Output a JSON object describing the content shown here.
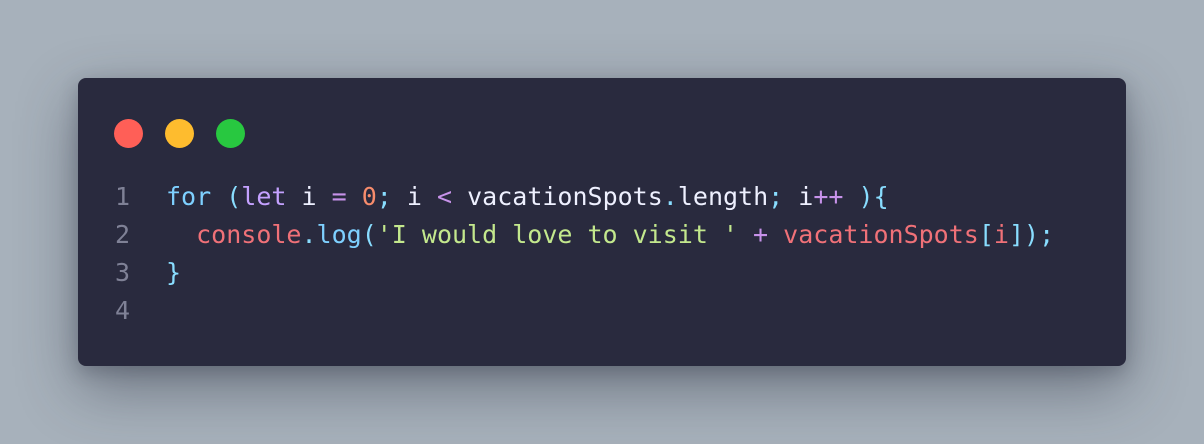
{
  "window_controls": {
    "close_color": "#ff5f57",
    "minimize_color": "#febc2e",
    "maximize_color": "#28c840"
  },
  "colors": {
    "keyword": "#7ed0ff",
    "storage": "#c4a1ff",
    "operator": "#c792ea",
    "number": "#f78c6c",
    "plain": "#eef0ff",
    "property": "#eef0ff",
    "variable_red": "#f07178",
    "string": "#c3e88d",
    "punctuation": "#89ddff",
    "line_number": "#7f8196"
  },
  "code": {
    "lines": [
      {
        "number": "1",
        "tokens": [
          {
            "text": "for",
            "type": "keyword"
          },
          {
            "text": " ",
            "type": "plain"
          },
          {
            "text": "(",
            "type": "punctuation"
          },
          {
            "text": "let",
            "type": "storage"
          },
          {
            "text": " i ",
            "type": "plain"
          },
          {
            "text": "=",
            "type": "operator"
          },
          {
            "text": " ",
            "type": "plain"
          },
          {
            "text": "0",
            "type": "number"
          },
          {
            "text": ";",
            "type": "punctuation"
          },
          {
            "text": " i ",
            "type": "plain"
          },
          {
            "text": "<",
            "type": "operator"
          },
          {
            "text": " vacationSpots",
            "type": "plain"
          },
          {
            "text": ".",
            "type": "punctuation"
          },
          {
            "text": "length",
            "type": "property"
          },
          {
            "text": ";",
            "type": "punctuation"
          },
          {
            "text": " i",
            "type": "plain"
          },
          {
            "text": "++",
            "type": "operator"
          },
          {
            "text": " ",
            "type": "plain"
          },
          {
            "text": ")",
            "type": "punctuation"
          },
          {
            "text": "{",
            "type": "punctuation"
          }
        ]
      },
      {
        "number": "2",
        "tokens": [
          {
            "text": "  ",
            "type": "plain"
          },
          {
            "text": "console",
            "type": "variable_red"
          },
          {
            "text": ".",
            "type": "punctuation"
          },
          {
            "text": "log",
            "type": "keyword"
          },
          {
            "text": "(",
            "type": "punctuation"
          },
          {
            "text": "'I would love to visit '",
            "type": "string"
          },
          {
            "text": " ",
            "type": "plain"
          },
          {
            "text": "+",
            "type": "operator"
          },
          {
            "text": " ",
            "type": "plain"
          },
          {
            "text": "vacationSpots",
            "type": "variable_red"
          },
          {
            "text": "[",
            "type": "punctuation"
          },
          {
            "text": "i",
            "type": "variable_red"
          },
          {
            "text": "]",
            "type": "punctuation"
          },
          {
            "text": ")",
            "type": "punctuation"
          },
          {
            "text": ";",
            "type": "punctuation"
          }
        ]
      },
      {
        "number": "3",
        "tokens": [
          {
            "text": "}",
            "type": "punctuation"
          }
        ]
      },
      {
        "number": "4",
        "tokens": []
      }
    ]
  }
}
